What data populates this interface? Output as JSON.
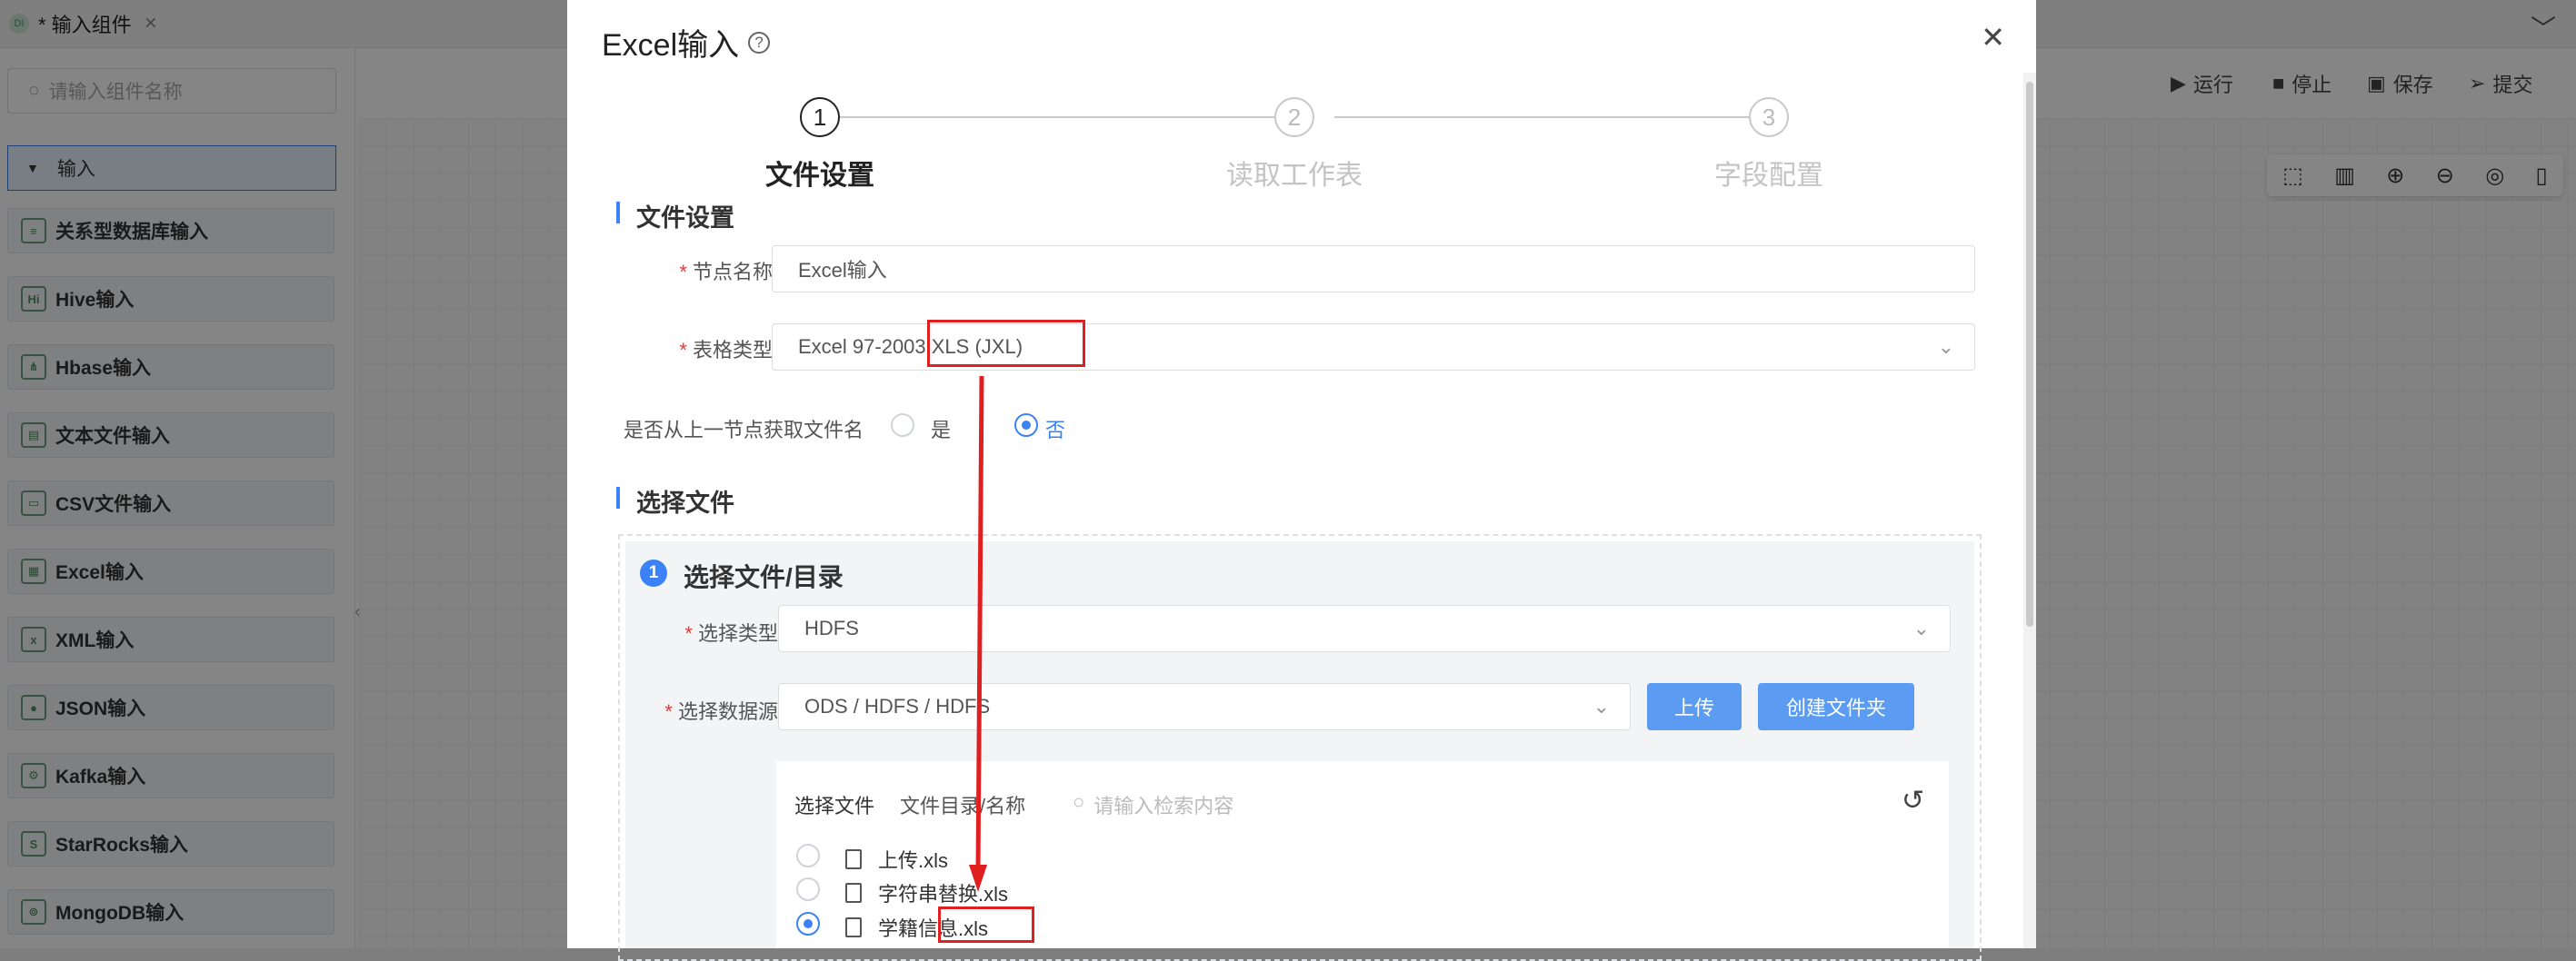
{
  "tab": {
    "label": "* 输入组件",
    "badge": "DI",
    "close": "×"
  },
  "sidebar": {
    "search_placeholder": "请输入组件名称",
    "group_label": "输入",
    "items": [
      {
        "label": "关系型数据库输入",
        "icon": "database-icon",
        "glyph": "≡"
      },
      {
        "label": "Hive输入",
        "icon": "hive-icon",
        "glyph": "Hi"
      },
      {
        "label": "Hbase输入",
        "icon": "hbase-icon",
        "glyph": "⋔"
      },
      {
        "label": "文本文件输入",
        "icon": "text-file-icon",
        "glyph": "▤"
      },
      {
        "label": "CSV文件输入",
        "icon": "csv-file-icon",
        "glyph": "▭"
      },
      {
        "label": "Excel输入",
        "icon": "excel-icon",
        "glyph": "▦"
      },
      {
        "label": "XML输入",
        "icon": "xml-icon",
        "glyph": "x"
      },
      {
        "label": "JSON输入",
        "icon": "json-icon",
        "glyph": "●"
      },
      {
        "label": "Kafka输入",
        "icon": "kafka-icon",
        "glyph": "⚙"
      },
      {
        "label": "StarRocks输入",
        "icon": "starrocks-icon",
        "glyph": "S"
      },
      {
        "label": "MongoDB输入",
        "icon": "mongodb-icon",
        "glyph": "⊚"
      }
    ]
  },
  "toolbar": {
    "run": "运行",
    "stop": "停止",
    "save": "保存",
    "submit": "提交"
  },
  "modal": {
    "title": "Excel输入",
    "steps": [
      {
        "num": "1",
        "label": "文件设置"
      },
      {
        "num": "2",
        "label": "读取工作表"
      },
      {
        "num": "3",
        "label": "字段配置"
      }
    ],
    "section_file_settings": "文件设置",
    "node_name_label": "节点名称",
    "node_name_value": "Excel输入",
    "table_type_label": "表格类型",
    "table_type_value": "Excel 97-2003 XLS (JXL)",
    "from_prev_label": "是否从上一节点获取文件名",
    "yes": "是",
    "no": "否",
    "section_select_file": "选择文件",
    "select_dir_num": "1",
    "select_dir_title": "选择文件/目录",
    "select_type_label": "选择类型",
    "select_type_value": "HDFS",
    "datasource_label": "选择数据源",
    "datasource_value": "ODS / HDFS / HDFS",
    "upload_btn": "上传",
    "create_folder_btn": "创建文件夹",
    "file_col_select": "选择文件",
    "file_col_name": "文件目录/名称",
    "file_search_placeholder": "请输入检索内容",
    "files": [
      {
        "name": "上传.xls",
        "checked": false
      },
      {
        "name": "字符串替换.xls",
        "checked": false
      },
      {
        "name": "学籍信息.xls",
        "checked": true
      }
    ]
  },
  "colors": {
    "accent": "#3b82f6",
    "button": "#5b9cf2",
    "annotation": "#e02020"
  }
}
